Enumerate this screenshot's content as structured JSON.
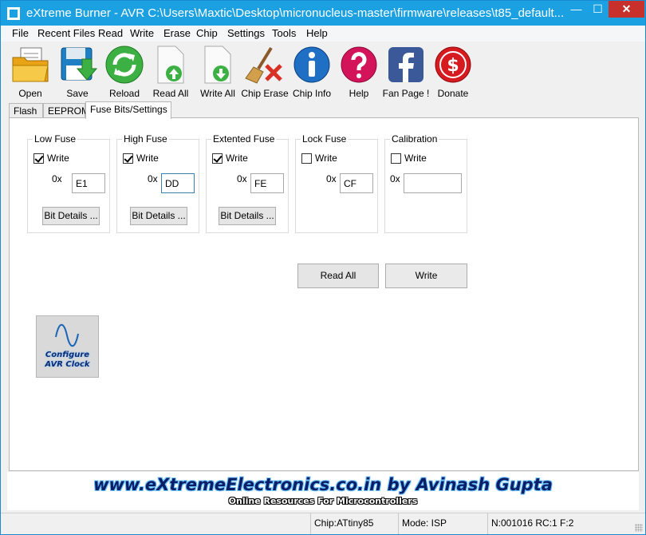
{
  "window": {
    "title": "eXtreme Burner - AVR C:\\Users\\Maxtic\\Desktop\\micronucleus-master\\firmware\\releases\\t85_default...",
    "min_glyph": "—",
    "max_glyph": "☐",
    "close_glyph": "✕"
  },
  "menu": [
    "File",
    "Recent Files",
    "Read",
    "Write",
    "Erase",
    "Chip",
    "Settings",
    "Tools",
    "Help"
  ],
  "toolbar": {
    "open": "Open",
    "save": "Save",
    "reload": "Reload",
    "read_all": "Read All",
    "write_all": "Write All",
    "chip_erase": "Chip Erase",
    "chip_info": "Chip Info",
    "help": "Help",
    "fan_page": "Fan Page !",
    "donate": "Donate"
  },
  "tabs": [
    "Flash",
    "EEPROM",
    "Fuse Bits/Settings"
  ],
  "active_tab": "Fuse Bits/Settings",
  "fuses": {
    "prefix": "0x",
    "write_label": "Write",
    "bit_details": "Bit Details ...",
    "low": {
      "title": "Low Fuse",
      "write_checked": true,
      "value": "E1"
    },
    "high": {
      "title": "High Fuse",
      "write_checked": true,
      "value": "DD"
    },
    "ext": {
      "title": "Extented Fuse",
      "write_checked": true,
      "value": "FE"
    },
    "lock": {
      "title": "Lock Fuse",
      "write_checked": false,
      "value": "CF"
    },
    "cal": {
      "title": "Calibration",
      "write_checked": false,
      "value": ""
    }
  },
  "actions": {
    "read_all": "Read All",
    "write": "Write"
  },
  "clock_button": {
    "line1": "Configure",
    "line2": "AVR Clock"
  },
  "banner": {
    "line1": "www.eXtremeElectronics.co.in by Avinash Gupta",
    "line2": "Online Resources For Microcontrollers"
  },
  "status": {
    "chip": "Chip:ATtiny85",
    "mode": "Mode: ISP",
    "counters": "N:001016 RC:1 F:2"
  },
  "colors": {
    "titlebar": "#1ba1e2",
    "close": "#c7302b",
    "banner_text": "#0b1f66"
  }
}
